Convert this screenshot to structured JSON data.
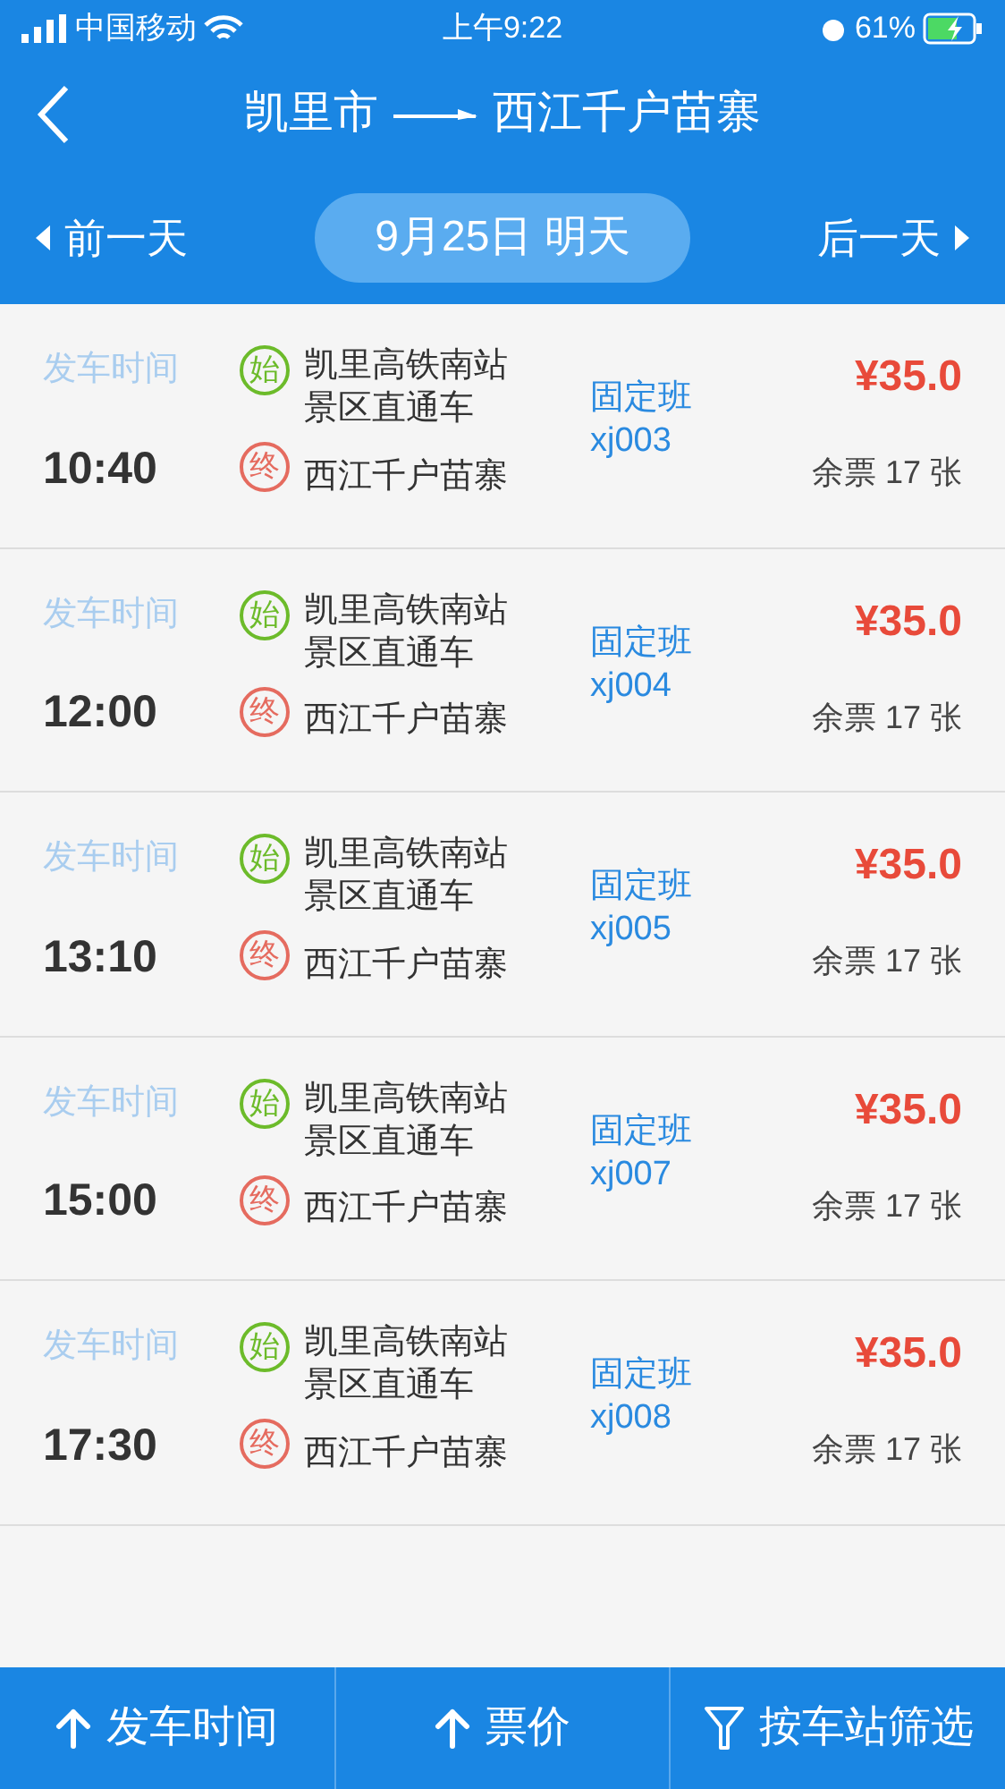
{
  "status_bar": {
    "carrier": "中国移动",
    "time": "上午9:22",
    "battery": "61%"
  },
  "header": {
    "from": "凯里市",
    "to": "西江千户苗寨"
  },
  "date_bar": {
    "prev": "前一天",
    "date": "9月25日 明天",
    "next": "后一天"
  },
  "trips": [
    {
      "time_label": "发车时间",
      "time": "10:40",
      "start_mark": "始",
      "start": "凯里高铁南站景区直通车",
      "end_mark": "终",
      "end": "西江千户苗寨",
      "type": "固定班",
      "code": "xj003",
      "price": "¥35.0",
      "seats": "余票 17 张"
    },
    {
      "time_label": "发车时间",
      "time": "12:00",
      "start_mark": "始",
      "start": "凯里高铁南站景区直通车",
      "end_mark": "终",
      "end": "西江千户苗寨",
      "type": "固定班",
      "code": "xj004",
      "price": "¥35.0",
      "seats": "余票 17 张"
    },
    {
      "time_label": "发车时间",
      "time": "13:10",
      "start_mark": "始",
      "start": "凯里高铁南站景区直通车",
      "end_mark": "终",
      "end": "西江千户苗寨",
      "type": "固定班",
      "code": "xj005",
      "price": "¥35.0",
      "seats": "余票 17 张"
    },
    {
      "time_label": "发车时间",
      "time": "15:00",
      "start_mark": "始",
      "start": "凯里高铁南站景区直通车",
      "end_mark": "终",
      "end": "西江千户苗寨",
      "type": "固定班",
      "code": "xj007",
      "price": "¥35.0",
      "seats": "余票 17 张"
    },
    {
      "time_label": "发车时间",
      "time": "17:30",
      "start_mark": "始",
      "start": "凯里高铁南站景区直通车",
      "end_mark": "终",
      "end": "西江千户苗寨",
      "type": "固定班",
      "code": "xj008",
      "price": "¥35.0",
      "seats": "余票 17 张"
    }
  ],
  "bottom_bar": [
    {
      "kind": "sort",
      "label": "发车时间"
    },
    {
      "kind": "sort",
      "label": "票价"
    },
    {
      "kind": "filter",
      "label": "按车站筛选"
    }
  ]
}
